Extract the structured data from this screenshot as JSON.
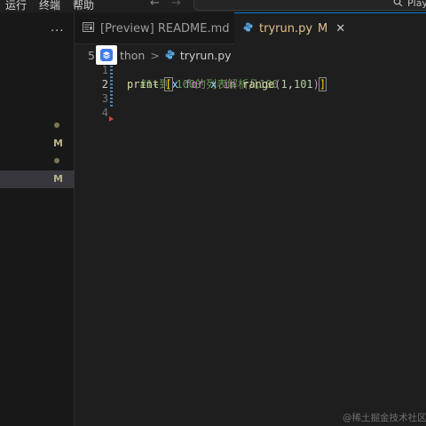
{
  "menu": {
    "items": [
      {
        "label": "运行",
        "name": "menu-run"
      },
      {
        "label": "终端",
        "name": "menu-terminal"
      },
      {
        "label": "帮助",
        "name": "menu-help"
      }
    ]
  },
  "titlebar": {
    "back_icon": "arrow-left-icon",
    "forward_icon": "arrow-right-icon",
    "command_center_text": "Play",
    "command_center_icon": "search-icon"
  },
  "sidebar": {
    "more_label": "···",
    "status_marks": [
      "●",
      "M",
      "●",
      "M"
    ]
  },
  "tabs": [
    {
      "label": "[Preview] README.md",
      "icon": "preview-icon",
      "active": false
    },
    {
      "label": "tryrun.py",
      "icon": "python-icon",
      "active": true,
      "modified": "M",
      "close": "✕"
    }
  ],
  "breadcrumb": {
    "folder": "5",
    "folder_rest": "thon",
    "separator": ">",
    "file": "tryrun.py",
    "file_icon": "python-icon"
  },
  "editor": {
    "line_numbers": [
      "1",
      "2",
      "3",
      "4"
    ],
    "active_line": "2",
    "line1": {
      "comment": "#1+到 100的列表解析几100"
    },
    "line2": {
      "print": "print",
      "space1": " ",
      "open": "[",
      "x1": "x",
      "sp2": " ",
      "for": "for",
      "sp3": " ",
      "x2": "x",
      "sp4": " ",
      "in": "in",
      "sp5": " ",
      "range": "range",
      "paren_open": "(",
      "n1": "1",
      "comma": ",",
      "n2": "101",
      "paren_close": ")",
      "close": "]"
    }
  },
  "colors": {
    "accent": "#0078d4",
    "modified": "#e2c08d",
    "comment": "#6a9955",
    "keyword": "#569cd6"
  },
  "watermark": "@稀土掘金技术社区"
}
